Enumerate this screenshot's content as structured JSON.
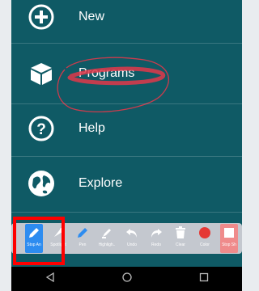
{
  "menu": {
    "items": [
      {
        "label": "New",
        "icon": "add-circle-icon"
      },
      {
        "label": "Programs",
        "icon": "cube-icon"
      },
      {
        "label": "Help",
        "icon": "help-circle-icon"
      },
      {
        "label": "Explore",
        "icon": "globe-icon"
      }
    ]
  },
  "annotation_toolbar": {
    "tools": [
      {
        "label": "Stop An",
        "icon": "pencil-icon",
        "active": true
      },
      {
        "label": "Spotlight",
        "icon": "spotlight-icon"
      },
      {
        "label": "Pen",
        "icon": "pen-icon"
      },
      {
        "label": "Highligh..",
        "icon": "highlighter-icon"
      },
      {
        "label": "Undo",
        "icon": "undo-icon"
      },
      {
        "label": "Redo",
        "icon": "redo-icon"
      },
      {
        "label": "Clear",
        "icon": "trash-icon"
      },
      {
        "label": "Color",
        "icon": "color-dot-icon"
      },
      {
        "label": "Stop Sh",
        "icon": "stop-share-icon"
      }
    ],
    "colors": {
      "active": "#2d8cf0",
      "color_dot": "#e53935",
      "stop_share": "#ef8b8b"
    }
  },
  "nav_bar": {
    "back": "back-icon",
    "home": "home-icon",
    "recents": "recents-icon"
  },
  "colors": {
    "background": "#0f5a65",
    "highlight_box": "#ff0000",
    "scribble": "#e0384a"
  }
}
